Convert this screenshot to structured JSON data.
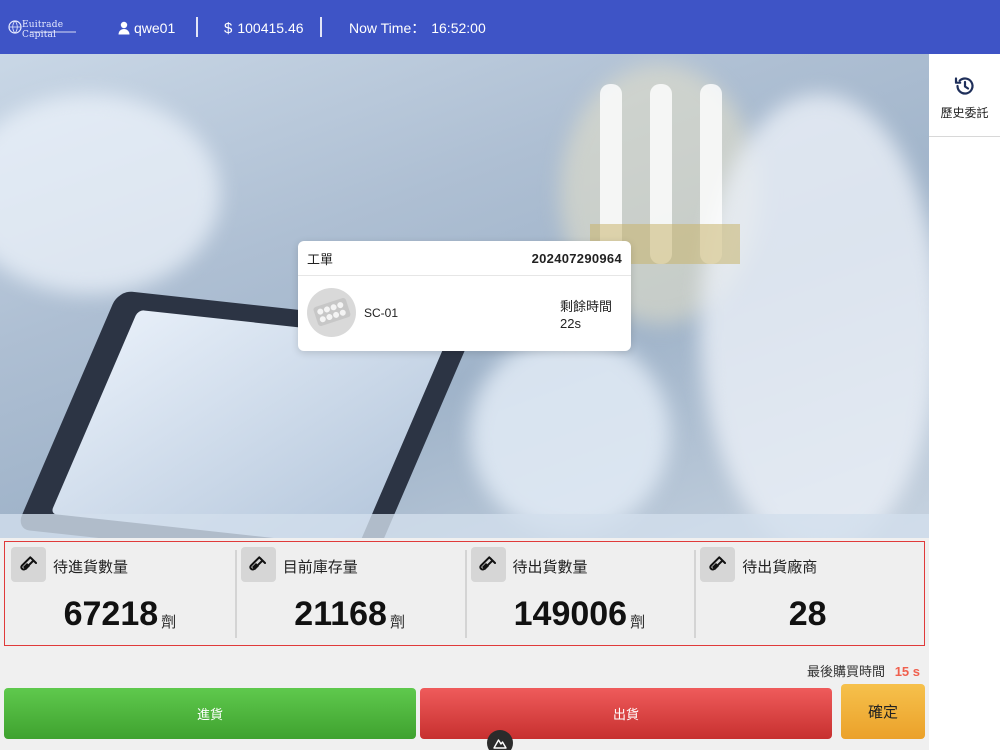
{
  "header": {
    "brand": "Euitrade Capital",
    "username": "qwe01",
    "balance_symbol": "$",
    "balance": "100415.46",
    "time_label": "Now Time：",
    "time_value": "16:52:00",
    "icons": {
      "user": "user-icon",
      "logo": "globe-logo-icon"
    }
  },
  "sidebar": {
    "history_label": "歷史委託",
    "history_icon": "history-icon"
  },
  "work_order": {
    "label": "工單",
    "order_id": "202407290964",
    "product_code": "SC-01",
    "remaining_label": "剩餘時間",
    "remaining_value": "22s",
    "thumb_icon": "pill-blister-icon"
  },
  "stats": [
    {
      "title": "待進貨數量",
      "value": "67218",
      "unit": "劑",
      "icon": "test-tube-icon"
    },
    {
      "title": "目前庫存量",
      "value": "21168",
      "unit": "劑",
      "icon": "test-tube-icon"
    },
    {
      "title": "待出貨數量",
      "value": "149006",
      "unit": "劑",
      "icon": "test-tube-icon"
    },
    {
      "title": "待出貨廠商",
      "value": "28",
      "unit": "",
      "icon": "test-tube-icon"
    }
  ],
  "last_purchase": {
    "label": "最後購買時間",
    "value": "15 s"
  },
  "actions": {
    "buy": "進貨",
    "sell": "出貨",
    "confirm": "確定"
  },
  "colors": {
    "header_bg": "#3e54c6",
    "buy": "#4cb33a",
    "sell": "#d94242",
    "confirm": "#f0b03a",
    "stats_border": "#e03a3a",
    "accent_seconds": "#f0604e"
  }
}
